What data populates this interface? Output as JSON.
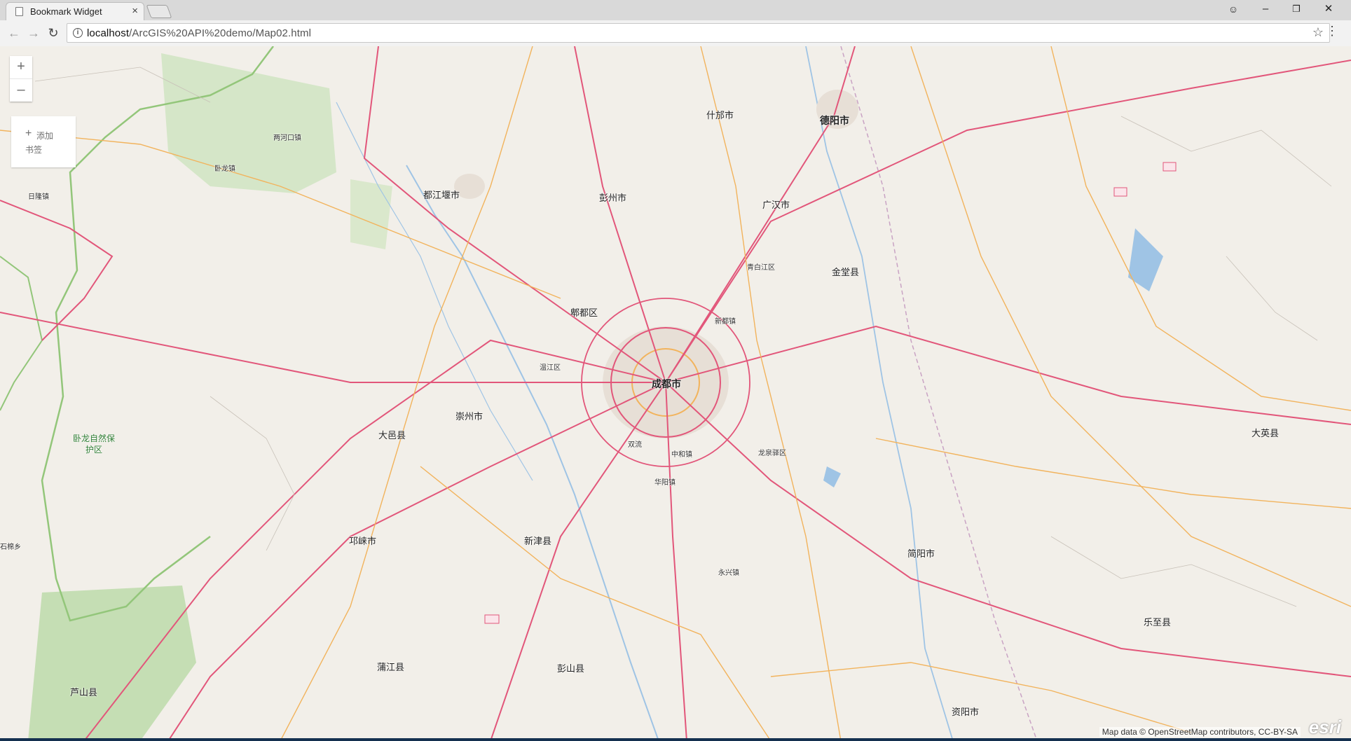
{
  "browser": {
    "tab_title": "Bookmark Widget",
    "url_host": "localhost",
    "url_path": "/ArcGIS%20API%20demo/Map02.html",
    "icons": {
      "favicon": "page-icon",
      "close": "close-icon",
      "back": "back-arrow-icon",
      "forward": "forward-arrow-icon",
      "reload": "reload-icon",
      "info": "info-icon",
      "bookmark": "star-icon",
      "menu": "menu-dots-icon",
      "account": "account-icon"
    },
    "window_controls": {
      "account": "☺",
      "minimize": "–",
      "maximize": "❐",
      "close": "✕"
    }
  },
  "map": {
    "zoom_in": "+",
    "zoom_out": "–",
    "bookmark_widget": {
      "add_label": "添加书签"
    },
    "attribution": "Map data © OpenStreetMap contributors, CC-BY-SA",
    "esri_logo": "esri",
    "colors": {
      "land": "#f2efe9",
      "road_major": "#e2567a",
      "road_secondary": "#f2b35c",
      "water": "#9fc4e5",
      "forest": "#c9e3b9",
      "boundary": "#93c67a"
    },
    "labels": {
      "chengdu": "成都市",
      "deyang": "德阳市",
      "guanghan": "广汉市",
      "pengzhou": "彭州市",
      "shifang": "什邡市",
      "dujiangyan": "都江堰市",
      "pixian": "郫都区",
      "jintang": "金堂县",
      "chongzhou": "崇州市",
      "dayi": "大邑县",
      "xinjin": "新津县",
      "qionglai": "邛崃市",
      "pujiang": "蒲江县",
      "pengshan": "彭山县",
      "jianyang": "简阳市",
      "ziyang": "资阳市",
      "lezhi": "乐至县",
      "daying": "大英县",
      "lushan": "芦山县",
      "wolong": "卧龙自然保护区",
      "qingbaijiang": "青白江区",
      "wenjiang": "温江区",
      "xindu": "新都镇",
      "longquanyi": "龙泉驿区",
      "huayang": "华阳镇",
      "shuangliu": "双流",
      "ziyang_town": "中和镇",
      "wolong_town": "卧龙镇",
      "rihe": "日隆镇",
      "lianghekou": "两河口镇",
      "yongxing": "永兴镇",
      "shimian": "石棉乡"
    }
  }
}
